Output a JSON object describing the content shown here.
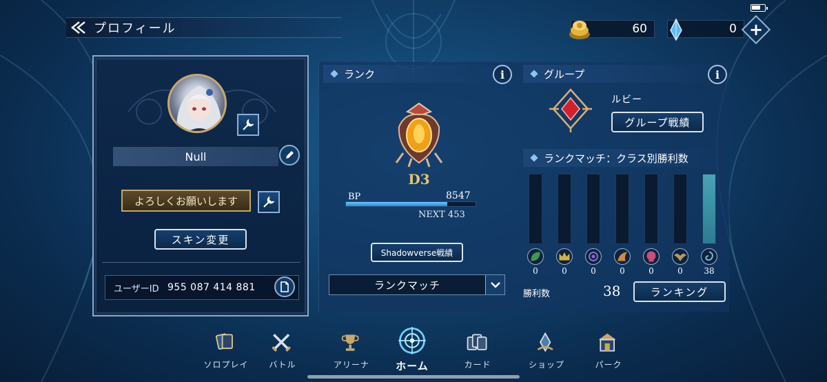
{
  "status_bar": {
    "battery_level": 0.7
  },
  "header": {
    "title": "プロフィール"
  },
  "currency": {
    "gold": "60",
    "crystal": "0"
  },
  "profile": {
    "name": "Null",
    "greeting": "よろしくお願いします",
    "skin_button": "スキン変更",
    "user_id_label": "ユーザーID",
    "user_id": "955 087 414 881"
  },
  "rank": {
    "section_title": "ランク",
    "rank_name": "D3",
    "bp_label": "BP",
    "bp_value": "8547",
    "bp_progress": 0.78,
    "next_label": "NEXT 453",
    "sv_button": "Shadowverse戦績",
    "mode_select": "ランクマッチ"
  },
  "group": {
    "section_title": "グループ",
    "group_name": "ルビー",
    "group_button": "グループ戦績"
  },
  "class_wins": {
    "section_title": "ランクマッチ：クラス別勝利数",
    "max": 38,
    "classes": [
      {
        "icon": "forestcraft-leaf-icon",
        "wins": "0",
        "value": 0,
        "color": "#3e9a4a"
      },
      {
        "icon": "swordcraft-crown-icon",
        "wins": "0",
        "value": 0,
        "color": "#d8b040"
      },
      {
        "icon": "runecraft-rune-icon",
        "wins": "0",
        "value": 0,
        "color": "#8f6ad6"
      },
      {
        "icon": "dragoncraft-claw-icon",
        "wins": "0",
        "value": 0,
        "color": "#d48a40"
      },
      {
        "icon": "shadowcraft-skull-icon",
        "wins": "0",
        "value": 0,
        "color": "#d04a7a"
      },
      {
        "icon": "bloodcraft-bat-icon",
        "wins": "0",
        "value": 0,
        "color": "#b89a5a"
      },
      {
        "icon": "havencraft-swirl-icon",
        "wins": "38",
        "value": 38,
        "color": "#7fb6d0"
      }
    ],
    "wins_label": "勝利数",
    "wins_total": "38",
    "ranking_button": "ランキング"
  },
  "nav": {
    "items": [
      {
        "label": "ソロプレイ",
        "icon": "solo-play-cards-icon"
      },
      {
        "label": "バトル",
        "icon": "battle-swords-icon"
      },
      {
        "label": "アリーナ",
        "icon": "arena-trophy-icon"
      },
      {
        "label": "ホーム",
        "icon": "home-compass-icon",
        "active": true
      },
      {
        "label": "カード",
        "icon": "cards-icon"
      },
      {
        "label": "ショップ",
        "icon": "shop-crystal-icon"
      },
      {
        "label": "パーク",
        "icon": "park-gate-icon"
      }
    ]
  }
}
